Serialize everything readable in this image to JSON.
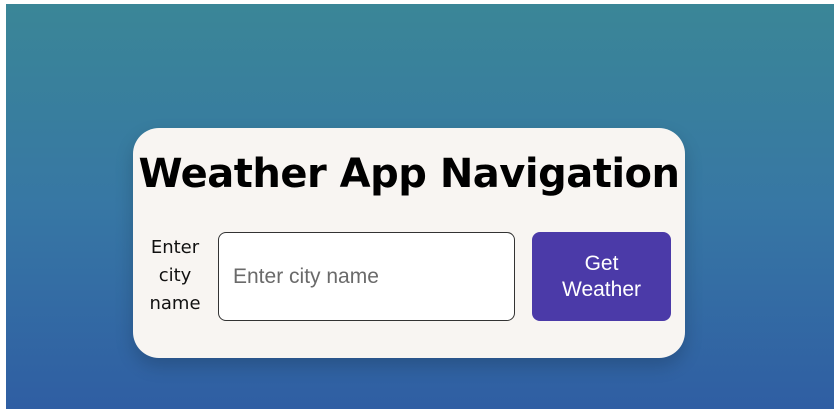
{
  "card": {
    "title": "Weather App Navigation",
    "form": {
      "label": "Enter city name",
      "input_placeholder": "Enter city name",
      "input_value": "",
      "button_label": "Get Weather"
    }
  },
  "colors": {
    "background_top": "#3a8697",
    "background_bottom": "#2f5ea3",
    "card_background": "#f8f5f2",
    "button_background": "#4b3aa8",
    "button_text": "#ffffff"
  }
}
